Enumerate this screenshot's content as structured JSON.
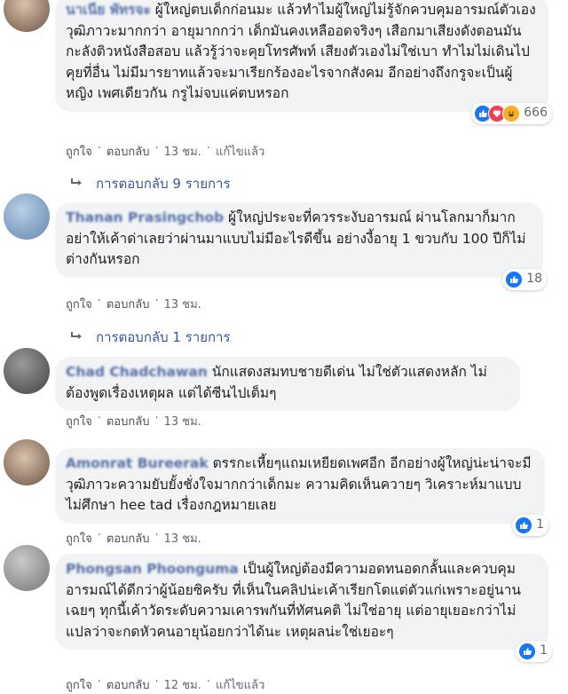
{
  "comments": [
    {
      "author": "นาเนีย พัทรจะ",
      "text": "ผู้ใหญ่ตบเด็กก่อนมะ แล้วทำไมผู้ใหญ่ไม่รู้จักควบคุมอารมณ์ตัวเอง วุฒิภาวะมากกว่า อายุมากกว่า เด็กมันคงเหลืออดจริงๆ เสือกมาเสียงดังตอนมันกะลังติวหนังสือสอบ แล้วรู้ว่าจะคุยโทรศัพท์ เสียงตัวเองไม่ใช่เบา ทำไมไม่เดินไปคุยที่อื่น ไม่มีมารยาทแล้วจะมาเรียกร้องอะไรจากสังคม อีกอย่างถึงกรูจะเป็นผู้หญิง เพศเดียวกัน กรูไม่จบแค่ตบหรอก",
      "reaction_count": "666",
      "like": "ถูกใจ",
      "reply": "ตอบกลับ",
      "time": "13 ชม.",
      "edited": "แก้ไขแล้ว",
      "replies_label": "การตอบกลับ 9 รายการ"
    },
    {
      "author": "Thanan Prasingchob",
      "text": "ผู้ใหญ่ประจะที่ควรระงับอารมณ์ ผ่านโลกมาก็มากอย่าให้เค้าด่าเลยว่าผ่านมาแบบไม่มีอะไรดีขึ้น อย่างงี้อายุ 1 ขวบกับ 100 ปีก็ไม่ต่างกันหรอก",
      "reaction_count": "18",
      "like": "ถูกใจ",
      "reply": "ตอบกลับ",
      "time": "13 ชม.",
      "replies_label": "การตอบกลับ 1 รายการ"
    },
    {
      "author": "Chad Chadchawan",
      "text": "นักแสดงสมทบชายดีเด่น ไม่ใช่ตัวแสดงหลัก ไม่ต้องพูดเรื่องเหตุผล แต่ได้ซีนไปเต็มๆ",
      "like": "ถูกใจ",
      "reply": "ตอบกลับ",
      "time": "13 ชม."
    },
    {
      "author": "Amonrat Bureerak",
      "text": "ตรรกะเหี้ยๆแถมเหยียดเพศอีก อีกอย่างผู้ใหญ่น่ะน่าจะมีวุฒิภาวะความยับยั้งชั่งใจมากกว่าเด็กมะ ความคิดเห็นควายๆ วิเคราะห์มาแบบไม่ศึกษา hee tad เรื่องกฎหมายเลย",
      "reaction_count": "1",
      "like": "ถูกใจ",
      "reply": "ตอบกลับ",
      "time": "13 ชม."
    },
    {
      "author": "Phongsan Phoonguma",
      "text": "เป็นผู้ใหญ่ต้องมีความอดทนอดกลั้นและควบคุมอารมณ์ได้ดีกว่าผู้น้อยซิครับ ที่เห็นในคลิปน่ะเค้าเรียกโตแต่ตัวแก่เพราะอยู่นานเฉยๆ ทุกนี้เค้าวัดระดับความเคารพกันที่ทัศนคติ ไม่ใช่อายุ แต่อายุเยอะกว่าไม่แปลว่าจะกดหัวคนอายุน้อยกว่าได้นะ เหตุผลน่ะใช่เยอะๆ",
      "reaction_count": "1",
      "like": "ถูกใจ",
      "reply": "ตอบกลับ",
      "time": "12 ชม.",
      "edited": "แก้ไขแล้ว"
    }
  ],
  "icons": {
    "like": "thumbs-up-icon",
    "love": "heart-icon",
    "haha": "laugh-icon",
    "reply_arrow": "reply-arrow-icon"
  },
  "colors": {
    "bubble": "#f2f3f5",
    "name": "#385898",
    "meta": "#606770",
    "like_blue": "#1877f2"
  }
}
